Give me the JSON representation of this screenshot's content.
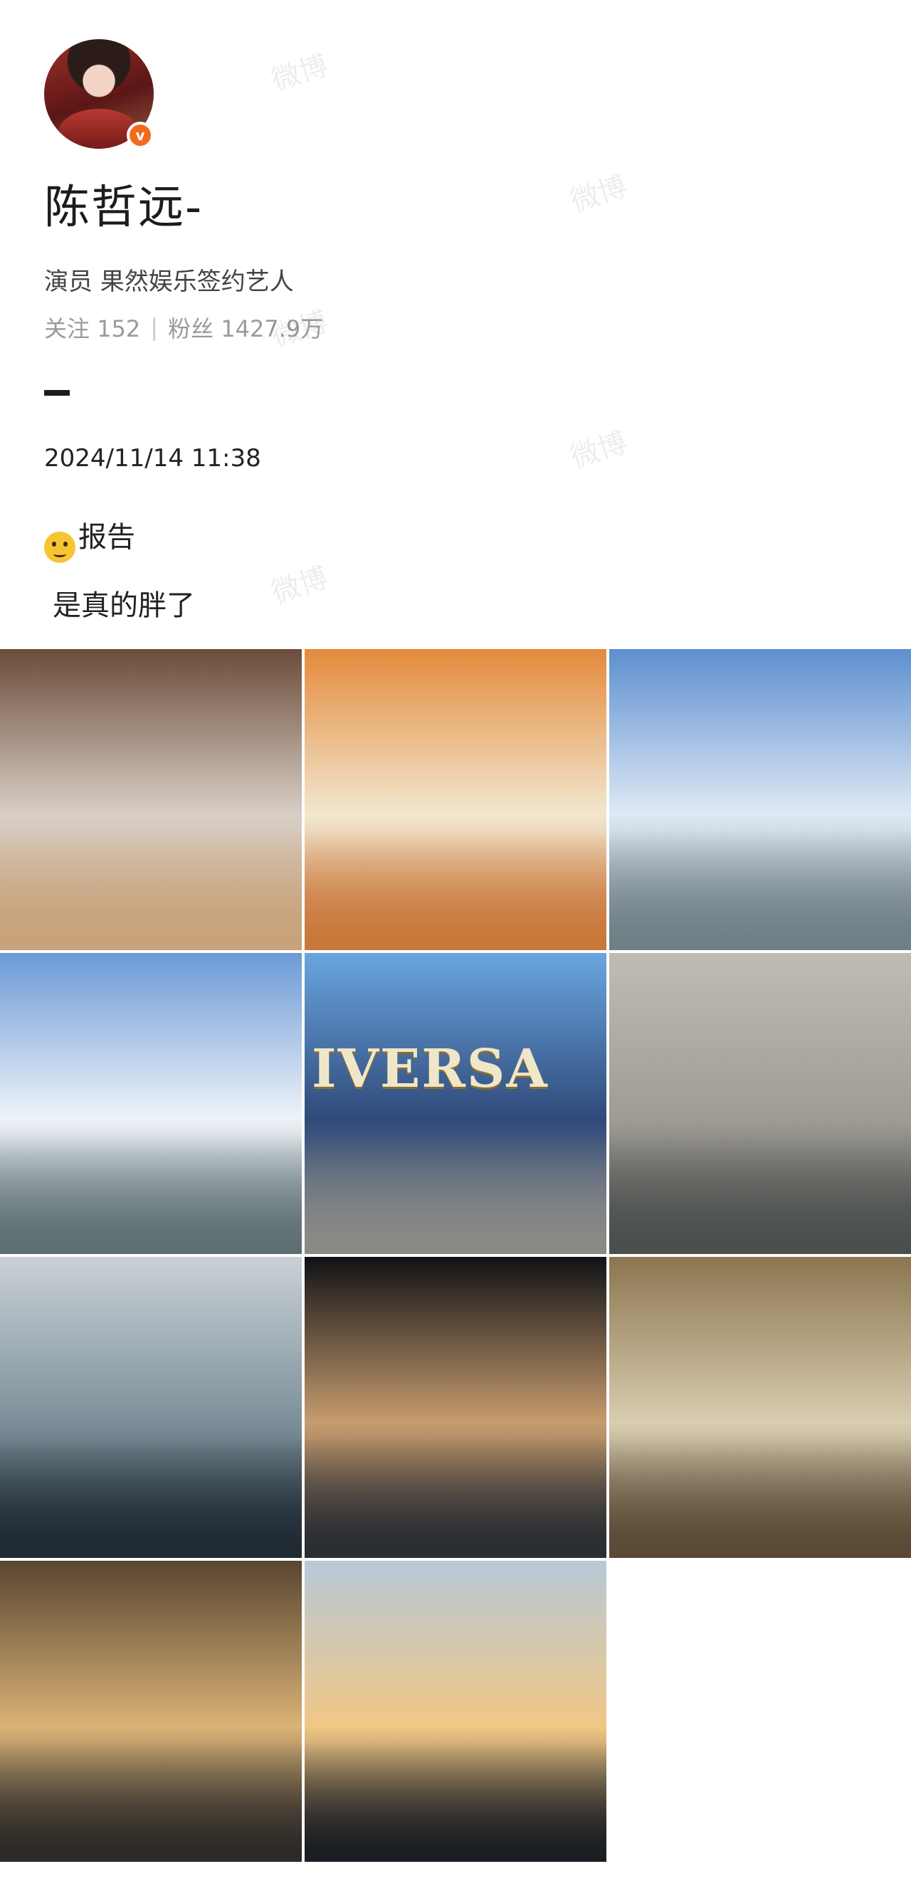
{
  "profile": {
    "name": "陈哲远-",
    "verified_badge": "v",
    "bio": "演员 果然娱乐签约艺人",
    "following_label": "关注",
    "following_count": "152",
    "followers_label": "粉丝",
    "followers_count": "1427.9万"
  },
  "post": {
    "timestamp": "2024/11/14 11:38",
    "emoji": "face-emoji",
    "line1": "报告",
    "line2": "是真的胖了"
  },
  "photo_grid": {
    "count": 11,
    "columns": 3,
    "images": [
      {
        "name": "photo-restaurant-peace-sign",
        "colors": [
          "#6b4b3a",
          "#d8cfc6",
          "#c7a27a"
        ]
      },
      {
        "name": "photo-chicken-rice-meal",
        "colors": [
          "#e48a3c",
          "#f2e7cf",
          "#c9773a"
        ]
      },
      {
        "name": "photo-merlion-skyline",
        "colors": [
          "#5d8fcf",
          "#dfe9f5",
          "#6f7f86"
        ]
      },
      {
        "name": "photo-merlion-cloudy-sky",
        "colors": [
          "#6b9ad6",
          "#eef3f8",
          "#5d6f73"
        ]
      },
      {
        "name": "photo-universal-globe",
        "colors": [
          "#6aa6e0",
          "#2f4a7a",
          "#8a8a85"
        ]
      },
      {
        "name": "photo-stone-arch-building",
        "colors": [
          "#bfbcb6",
          "#9f9b95",
          "#4a4f4c"
        ]
      },
      {
        "name": "photo-boat-sea",
        "colors": [
          "#c9d1d6",
          "#7c8f99",
          "#1f2a33"
        ]
      },
      {
        "name": "photo-fish-catch-night",
        "colors": [
          "#101215",
          "#c79c6e",
          "#2a2e33"
        ]
      },
      {
        "name": "photo-clams-in-bowl",
        "colors": [
          "#8c7550",
          "#d8cdb0",
          "#5a4a35"
        ]
      },
      {
        "name": "photo-grilled-seafood-tray",
        "colors": [
          "#5a4630",
          "#d9b277",
          "#2c2a28"
        ]
      },
      {
        "name": "photo-sunset-sea-boat",
        "colors": [
          "#b7c9d8",
          "#f1c785",
          "#1a1d22"
        ]
      }
    ],
    "universal_sign_text": "IVERSA"
  },
  "watermark": "微博"
}
